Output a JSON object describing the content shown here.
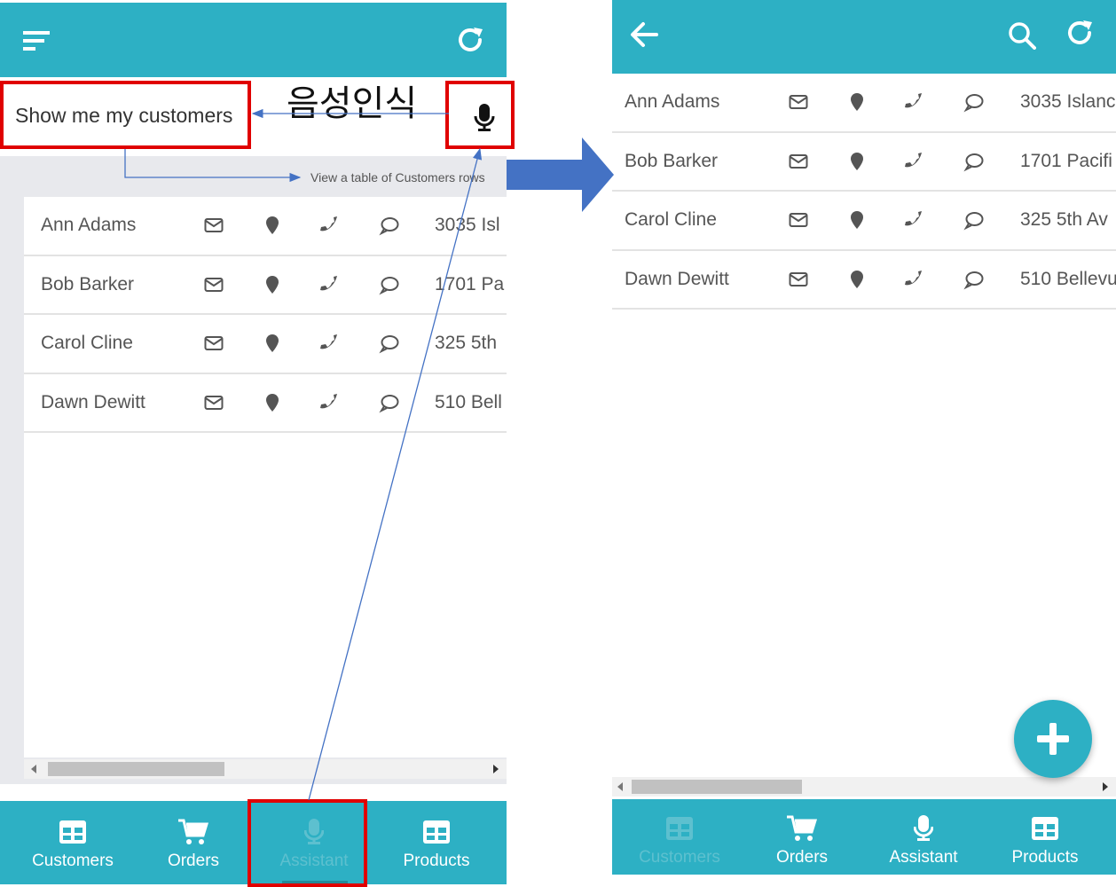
{
  "annotations": {
    "voice_label": "음성인식",
    "hint_text": "View a table of Customers rows"
  },
  "left_screen": {
    "header": {
      "menu_icon": "menu-icon",
      "refresh_icon": "refresh-icon"
    },
    "voice_query": "Show me my customers",
    "mic_icon": "microphone-icon",
    "rows": [
      {
        "name": "Ann Adams",
        "address": "3035 Isl"
      },
      {
        "name": "Bob Barker",
        "address": "1701 Pa"
      },
      {
        "name": "Carol Cline",
        "address": "325 5th"
      },
      {
        "name": "Dawn Dewitt",
        "address": "510 Bell"
      }
    ],
    "nav": [
      {
        "label": "Customers",
        "icon": "table-icon"
      },
      {
        "label": "Orders",
        "icon": "cart-icon"
      },
      {
        "label": "Assistant",
        "icon": "microphone-icon"
      },
      {
        "label": "Products",
        "icon": "table-icon"
      }
    ]
  },
  "right_screen": {
    "header": {
      "back_icon": "arrow-left-icon",
      "search_icon": "search-icon",
      "refresh_icon": "refresh-icon"
    },
    "rows": [
      {
        "name": "Ann Adams",
        "address": "3035 Islanc"
      },
      {
        "name": "Bob Barker",
        "address": "1701 Pacifi"
      },
      {
        "name": "Carol Cline",
        "address": "325 5th Av"
      },
      {
        "name": "Dawn Dewitt",
        "address": "510 Bellevu"
      }
    ],
    "fab_icon": "plus-icon",
    "nav": [
      {
        "label": "Customers",
        "icon": "table-icon"
      },
      {
        "label": "Orders",
        "icon": "cart-icon"
      },
      {
        "label": "Assistant",
        "icon": "microphone-icon"
      },
      {
        "label": "Products",
        "icon": "table-icon"
      }
    ]
  },
  "colors": {
    "accent": "#2db0c4",
    "highlight": "#e00000",
    "arrow": "#4472c4"
  }
}
